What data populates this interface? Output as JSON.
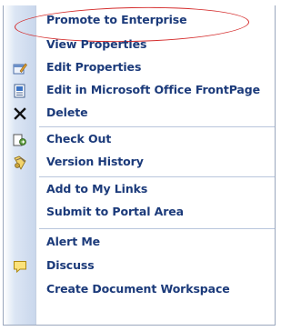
{
  "context_menu": {
    "items": [
      {
        "label": "Promote to Enterprise",
        "icon": null
      },
      {
        "label": "View Properties",
        "icon": null
      },
      {
        "label": "Edit Properties",
        "icon": "edit-properties-icon"
      },
      {
        "label": "Edit in Microsoft Office FrontPage",
        "icon": "frontpage-icon"
      },
      {
        "label": "Delete",
        "icon": "delete-x-icon"
      },
      {
        "label": "Check Out",
        "icon": "check-out-icon"
      },
      {
        "label": "Version History",
        "icon": "version-history-icon"
      },
      {
        "label": "Add to My Links",
        "icon": null
      },
      {
        "label": "Submit to Portal Area",
        "icon": null
      },
      {
        "label": "Alert Me",
        "icon": null
      },
      {
        "label": "Discuss",
        "icon": "discuss-icon"
      },
      {
        "label": "Create Document Workspace",
        "icon": null
      }
    ]
  },
  "colors": {
    "label_text": "#1b3a7a",
    "gutter": "#c9d7ec",
    "separator": "#b9c6dc",
    "highlight_ellipse": "#d42a2a"
  }
}
